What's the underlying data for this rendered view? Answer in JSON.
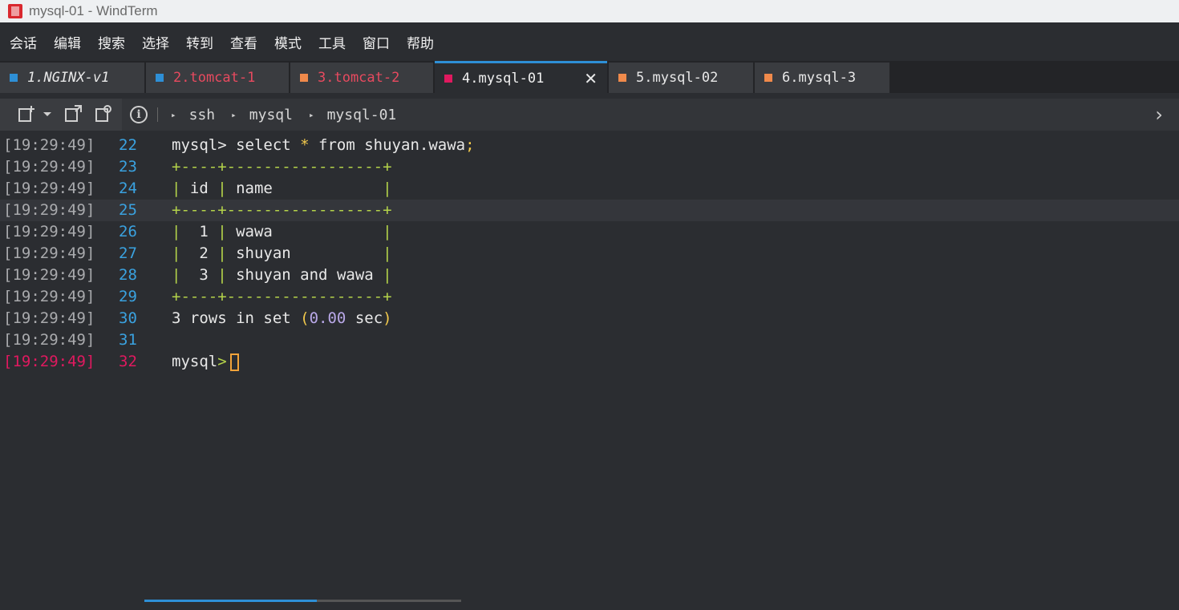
{
  "window": {
    "title": "mysql-01 - WindTerm"
  },
  "menu": [
    "会话",
    "编辑",
    "搜索",
    "选择",
    "转到",
    "查看",
    "模式",
    "工具",
    "窗口",
    "帮助"
  ],
  "tabs": [
    {
      "label": "1.NGINX-v1",
      "color": "#2e8fd6",
      "text_color": "#e8e8e8",
      "italic": true
    },
    {
      "label": "2.tomcat-1",
      "color": "#2e8fd6",
      "text_color": "#e84a5f"
    },
    {
      "label": "3.tomcat-2",
      "color": "#f08a4b",
      "text_color": "#e84a5f"
    },
    {
      "label": "4.mysql-01",
      "color": "#e0195f",
      "text_color": "#f0f0f0",
      "active": true,
      "close": "✕"
    },
    {
      "label": "5.mysql-02",
      "color": "#f08a4b",
      "text_color": "#e8e8e8"
    },
    {
      "label": "6.mysql-3",
      "color": "#f08a4b",
      "text_color": "#e8e8e8"
    }
  ],
  "breadcrumb": [
    "ssh",
    "mysql",
    "mysql-01"
  ],
  "terminal": {
    "lines": [
      {
        "time": "[19:29:49]",
        "num": "22"
      },
      {
        "time": "[19:29:49]",
        "num": "23"
      },
      {
        "time": "[19:29:49]",
        "num": "24"
      },
      {
        "time": "[19:29:49]",
        "num": "25"
      },
      {
        "time": "[19:29:49]",
        "num": "26"
      },
      {
        "time": "[19:29:49]",
        "num": "27"
      },
      {
        "time": "[19:29:49]",
        "num": "28"
      },
      {
        "time": "[19:29:49]",
        "num": "29"
      },
      {
        "time": "[19:29:49]",
        "num": "30"
      },
      {
        "time": "[19:29:49]",
        "num": "31"
      },
      {
        "time": "[19:29:49]",
        "num": "32"
      }
    ],
    "prompt": "mysql>",
    "query": " select * from shuyan.wawa;",
    "border": "+----+-----------------+",
    "header_id": "id",
    "header_name": "name",
    "rows": [
      {
        "id": "1",
        "name": "wawa"
      },
      {
        "id": "2",
        "name": "shuyan"
      },
      {
        "id": "3",
        "name": "shuyan and wawa"
      }
    ],
    "result_count": "3 rows in set",
    "result_time": "0.00",
    "result_unit": "sec",
    "active_color": "#e0195f"
  }
}
